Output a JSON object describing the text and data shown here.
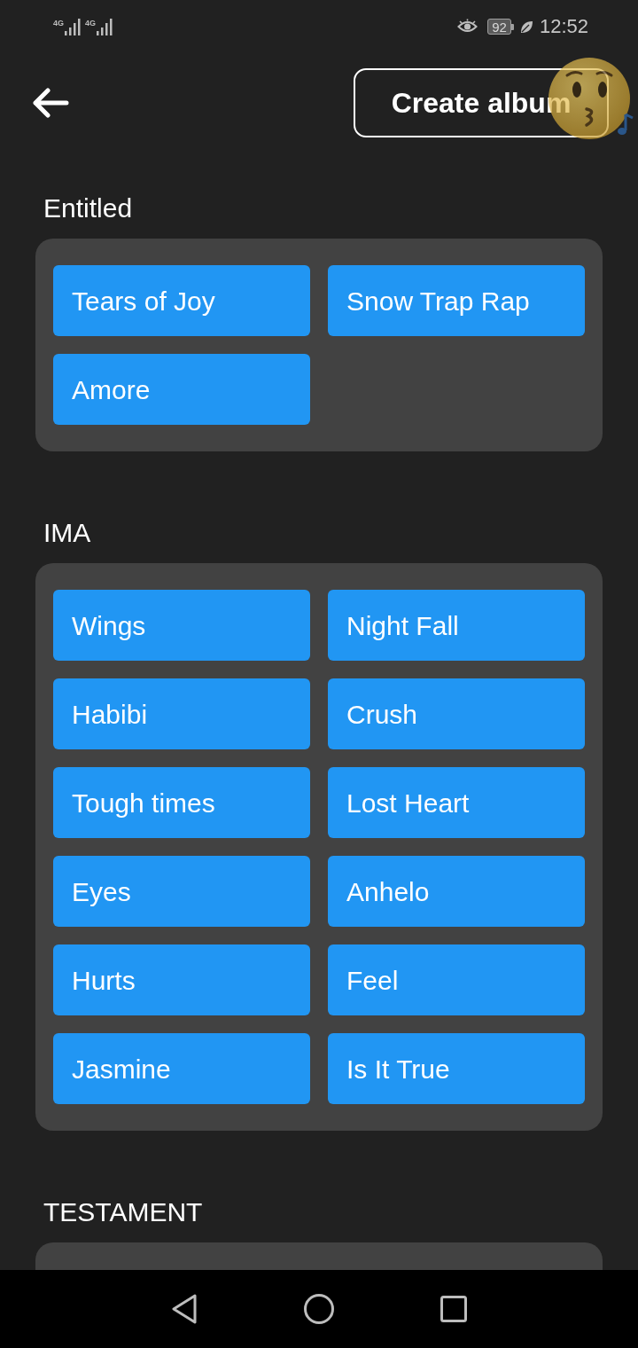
{
  "status_bar": {
    "networks": [
      {
        "label": "4G"
      },
      {
        "label": "4G"
      }
    ],
    "battery": "92",
    "time": "12:52"
  },
  "header": {
    "create_button": "Create album"
  },
  "albums": [
    {
      "title": "Entitled",
      "songs": [
        {
          "label": "Tears of Joy"
        },
        {
          "label": "Snow Trap Rap"
        },
        {
          "label": "Amore"
        }
      ]
    },
    {
      "title": "IMA",
      "songs": [
        {
          "label": "Wings"
        },
        {
          "label": "Night Fall"
        },
        {
          "label": "Habibi"
        },
        {
          "label": "Crush"
        },
        {
          "label": "Tough times"
        },
        {
          "label": "Lost Heart"
        },
        {
          "label": "Eyes"
        },
        {
          "label": "Anhelo"
        },
        {
          "label": "Hurts"
        },
        {
          "label": "Feel"
        },
        {
          "label": "Jasmine"
        },
        {
          "label": "Is It True"
        }
      ]
    },
    {
      "title": "TESTAMENT"
    }
  ]
}
